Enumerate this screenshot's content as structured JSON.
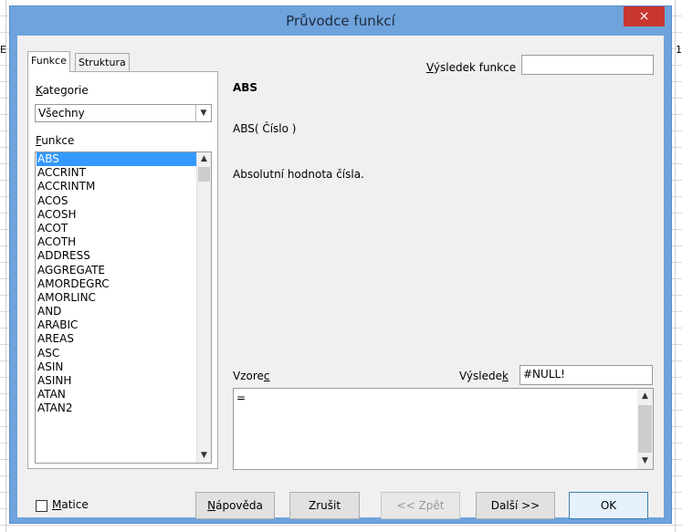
{
  "background": {
    "left_edge": "E",
    "right_edge": "1"
  },
  "dialog": {
    "title": "Průvodce funkcí",
    "close_glyph": "×"
  },
  "tabs": [
    {
      "label": "Funkce",
      "active": true
    },
    {
      "label": "Struktura",
      "active": false
    }
  ],
  "left": {
    "category_label": "Kategorie",
    "category_value": "Všechny",
    "function_label": "Funkce",
    "functions": [
      "ABS",
      "ACCRINT",
      "ACCRINTM",
      "ACOS",
      "ACOSH",
      "ACOT",
      "ACOTH",
      "ADDRESS",
      "AGGREGATE",
      "AMORDEGRC",
      "AMORLINC",
      "AND",
      "ARABIC",
      "AREAS",
      "ASC",
      "ASIN",
      "ASINH",
      "ATAN",
      "ATAN2"
    ],
    "selected_function": "ABS"
  },
  "right": {
    "function_result_label": "Výsledek funkce",
    "function_result_value": "",
    "function_name": "ABS",
    "syntax": "ABS( Číslo )",
    "description": "Absolutní hodnota čísla.",
    "formula_label": "Vzorec",
    "result_label": "Výsledek",
    "result_value": "#NULL!",
    "formula_text": "="
  },
  "footer": {
    "matrix_label": "Matice",
    "help_button": "Nápověda",
    "cancel_button": "Zrušit",
    "back_button": "<< Zpět",
    "next_button": "Další >>",
    "ok_button": "OK"
  },
  "colors": {
    "titlebar": "#6fa3dc",
    "close": "#c7372f",
    "selection": "#3399ff"
  }
}
